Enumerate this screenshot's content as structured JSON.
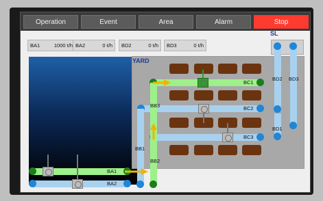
{
  "tabs": [
    {
      "label": "Operation"
    },
    {
      "label": "Event"
    },
    {
      "label": "Area"
    },
    {
      "label": "Alarm"
    },
    {
      "label": "Stop"
    }
  ],
  "readouts": [
    {
      "name": "BA1",
      "value": "1000 t/h"
    },
    {
      "name": "BA2",
      "value": "0 t/h"
    },
    {
      "name": "BD2",
      "value": "0 t/h"
    },
    {
      "name": "BD3",
      "value": "0 t/h"
    }
  ],
  "yard": {
    "title": "YARD"
  },
  "sl": {
    "title": "SL"
  },
  "belts": {
    "bc1": "BC1",
    "bc2": "BC2",
    "bc3": "BC3",
    "bd1": "BD1",
    "bd2": "BD2",
    "bd3": "BD3",
    "bb1": "BB1",
    "bb2": "BB2",
    "bb3": "BB3",
    "ba1": "BA1",
    "ba2": "BA2"
  },
  "colors": {
    "active": "#9ef08a",
    "idle": "#a8d1f0",
    "stop": "#ff3b30",
    "pile": "#6b3410",
    "arrow": "#f0b400"
  }
}
